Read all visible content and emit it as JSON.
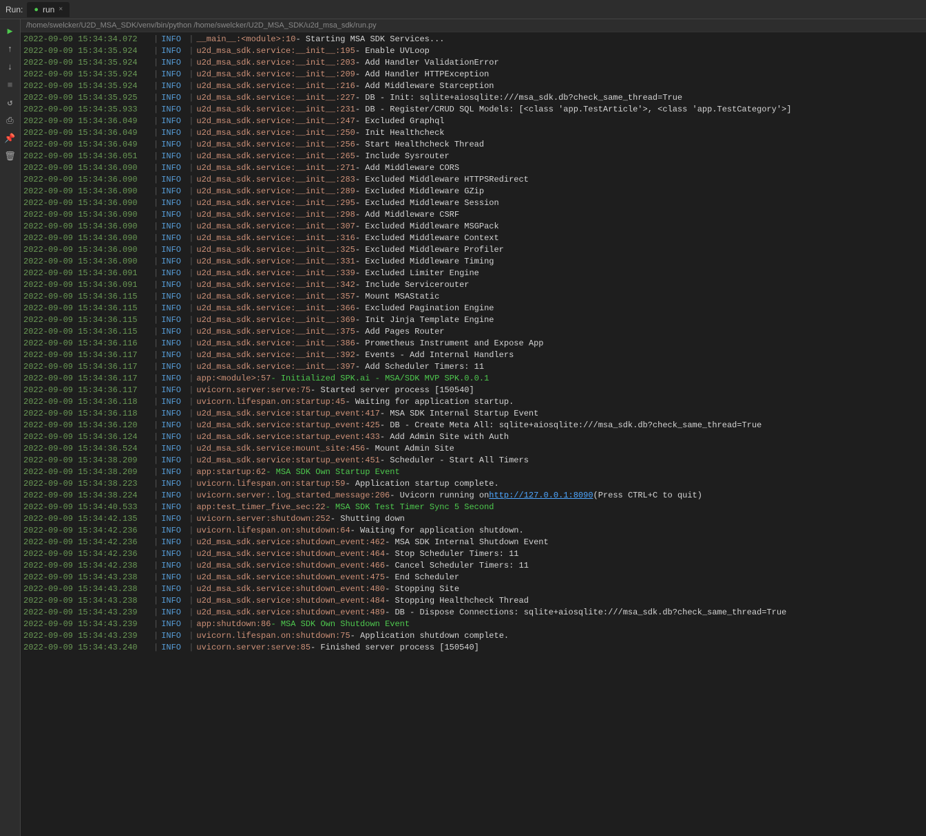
{
  "topbar": {
    "run_label": "Run:",
    "tab_label": "run",
    "tab_close": "×"
  },
  "path_bar": "/home/swelcker/U2D_MSA_SDK/venv/bin/python /home/swelcker/U2D_MSA_SDK/u2d_msa_sdk/run.py",
  "toolbar": {
    "play": "▶",
    "up": "↑",
    "down": "↓",
    "stop": "■",
    "rerun": "↺",
    "print": "⎙",
    "pin": "📌",
    "trash": "🗑"
  },
  "log_lines": [
    {
      "ts": "2022-09-09 15:34:34.072",
      "level": "INFO",
      "source": "__main__:<module>:10",
      "msg": " - Starting MSA SDK Services...",
      "color": "plain"
    },
    {
      "ts": "2022-09-09 15:34:35.924",
      "level": "INFO",
      "source": "u2d_msa_sdk.service:__init__:195",
      "msg": " - Enable UVLoop",
      "color": "plain"
    },
    {
      "ts": "2022-09-09 15:34:35.924",
      "level": "INFO",
      "source": "u2d_msa_sdk.service:__init__:203",
      "msg": " - Add Handler ValidationError",
      "color": "plain"
    },
    {
      "ts": "2022-09-09 15:34:35.924",
      "level": "INFO",
      "source": "u2d_msa_sdk.service:__init__:209",
      "msg": " - Add Handler HTTPException",
      "color": "plain"
    },
    {
      "ts": "2022-09-09 15:34:35.924",
      "level": "INFO",
      "source": "u2d_msa_sdk.service:__init__:216",
      "msg": " - Add Middleware Starception",
      "color": "plain"
    },
    {
      "ts": "2022-09-09 15:34:35.925",
      "level": "INFO",
      "source": "u2d_msa_sdk.service:__init__:227",
      "msg": " - DB - Init: sqlite+aiosqlite:///msa_sdk.db?check_same_thread=True",
      "color": "plain"
    },
    {
      "ts": "2022-09-09 15:34:35.933",
      "level": "INFO",
      "source": "u2d_msa_sdk.service:__init__:231",
      "msg": " - DB - Register/CRUD SQL Models: [<class 'app.TestArticle'>, <class 'app.TestCategory'>]",
      "color": "plain"
    },
    {
      "ts": "2022-09-09 15:34:36.049",
      "level": "INFO",
      "source": "u2d_msa_sdk.service:__init__:247",
      "msg": " - Excluded Graphql",
      "color": "plain"
    },
    {
      "ts": "2022-09-09 15:34:36.049",
      "level": "INFO",
      "source": "u2d_msa_sdk.service:__init__:250",
      "msg": " - Init Healthcheck",
      "color": "plain"
    },
    {
      "ts": "2022-09-09 15:34:36.049",
      "level": "INFO",
      "source": "u2d_msa_sdk.service:__init__:256",
      "msg": " - Start Healthcheck Thread",
      "color": "plain"
    },
    {
      "ts": "2022-09-09 15:34:36.051",
      "level": "INFO",
      "source": "u2d_msa_sdk.service:__init__:265",
      "msg": " - Include Sysrouter",
      "color": "plain"
    },
    {
      "ts": "2022-09-09 15:34:36.090",
      "level": "INFO",
      "source": "u2d_msa_sdk.service:__init__:271",
      "msg": " - Add Middleware CORS",
      "color": "plain"
    },
    {
      "ts": "2022-09-09 15:34:36.090",
      "level": "INFO",
      "source": "u2d_msa_sdk.service:__init__:283",
      "msg": " - Excluded Middleware HTTPSRedirect",
      "color": "plain"
    },
    {
      "ts": "2022-09-09 15:34:36.090",
      "level": "INFO",
      "source": "u2d_msa_sdk.service:__init__:289",
      "msg": " - Excluded Middleware GZip",
      "color": "plain"
    },
    {
      "ts": "2022-09-09 15:34:36.090",
      "level": "INFO",
      "source": "u2d_msa_sdk.service:__init__:295",
      "msg": " - Excluded Middleware Session",
      "color": "plain"
    },
    {
      "ts": "2022-09-09 15:34:36.090",
      "level": "INFO",
      "source": "u2d_msa_sdk.service:__init__:298",
      "msg": " - Add Middleware CSRF",
      "color": "plain"
    },
    {
      "ts": "2022-09-09 15:34:36.090",
      "level": "INFO",
      "source": "u2d_msa_sdk.service:__init__:307",
      "msg": " - Excluded Middleware MSGPack",
      "color": "plain"
    },
    {
      "ts": "2022-09-09 15:34:36.090",
      "level": "INFO",
      "source": "u2d_msa_sdk.service:__init__:316",
      "msg": " - Excluded Middleware Context",
      "color": "plain"
    },
    {
      "ts": "2022-09-09 15:34:36.090",
      "level": "INFO",
      "source": "u2d_msa_sdk.service:__init__:325",
      "msg": " - Excluded Middleware Profiler",
      "color": "plain"
    },
    {
      "ts": "2022-09-09 15:34:36.090",
      "level": "INFO",
      "source": "u2d_msa_sdk.service:__init__:331",
      "msg": " - Excluded Middleware Timing",
      "color": "plain"
    },
    {
      "ts": "2022-09-09 15:34:36.091",
      "level": "INFO",
      "source": "u2d_msa_sdk.service:__init__:339",
      "msg": " - Excluded Limiter Engine",
      "color": "plain"
    },
    {
      "ts": "2022-09-09 15:34:36.091",
      "level": "INFO",
      "source": "u2d_msa_sdk.service:__init__:342",
      "msg": " - Include Servicerouter",
      "color": "plain"
    },
    {
      "ts": "2022-09-09 15:34:36.115",
      "level": "INFO",
      "source": "u2d_msa_sdk.service:__init__:357",
      "msg": " - Mount MSAStatic",
      "color": "plain"
    },
    {
      "ts": "2022-09-09 15:34:36.115",
      "level": "INFO",
      "source": "u2d_msa_sdk.service:__init__:366",
      "msg": " - Excluded Pagination Engine",
      "color": "plain"
    },
    {
      "ts": "2022-09-09 15:34:36.115",
      "level": "INFO",
      "source": "u2d_msa_sdk.service:__init__:369",
      "msg": " - Init Jinja Template Engine",
      "color": "plain"
    },
    {
      "ts": "2022-09-09 15:34:36.115",
      "level": "INFO",
      "source": "u2d_msa_sdk.service:__init__:375",
      "msg": " - Add Pages Router",
      "color": "plain"
    },
    {
      "ts": "2022-09-09 15:34:36.116",
      "level": "INFO",
      "source": "u2d_msa_sdk.service:__init__:386",
      "msg": " - Prometheus Instrument and Expose App",
      "color": "plain"
    },
    {
      "ts": "2022-09-09 15:34:36.117",
      "level": "INFO",
      "source": "u2d_msa_sdk.service:__init__:392",
      "msg": " - Events - Add Internal Handlers",
      "color": "plain"
    },
    {
      "ts": "2022-09-09 15:34:36.117",
      "level": "INFO",
      "source": "u2d_msa_sdk.service:__init__:397",
      "msg": " - Add Scheduler Timers: 11",
      "color": "plain"
    },
    {
      "ts": "2022-09-09 15:34:36.117",
      "level": "INFO",
      "source": "app:<module>:57",
      "msg": " - Initialized SPK.ai - MSA/SDK MVP SPK.0.0.1",
      "color": "green"
    },
    {
      "ts": "2022-09-09 15:34:36.117",
      "level": "INFO",
      "source": "uvicorn.server:serve:75",
      "msg": " - Started server process [150540]",
      "color": "plain"
    },
    {
      "ts": "2022-09-09 15:34:36.118",
      "level": "INFO",
      "source": "uvicorn.lifespan.on:startup:45",
      "msg": " - Waiting for application startup.",
      "color": "plain"
    },
    {
      "ts": "2022-09-09 15:34:36.118",
      "level": "INFO",
      "source": "u2d_msa_sdk.service:startup_event:417",
      "msg": " - MSA SDK Internal Startup Event",
      "color": "plain"
    },
    {
      "ts": "2022-09-09 15:34:36.120",
      "level": "INFO",
      "source": "u2d_msa_sdk.service:startup_event:425",
      "msg": " - DB - Create Meta All: sqlite+aiosqlite:///msa_sdk.db?check_same_thread=True",
      "color": "plain"
    },
    {
      "ts": "2022-09-09 15:34:36.124",
      "level": "INFO",
      "source": "u2d_msa_sdk.service:startup_event:433",
      "msg": " - Add Admin Site with Auth",
      "color": "plain"
    },
    {
      "ts": "2022-09-09 15:34:36.524",
      "level": "INFO",
      "source": "u2d_msa_sdk.service:mount_site:456",
      "msg": " - Mount Admin Site",
      "color": "plain"
    },
    {
      "ts": "2022-09-09 15:34:38.209",
      "level": "INFO",
      "source": "u2d_msa_sdk.service:startup_event:451",
      "msg": " - Scheduler - Start All Timers",
      "color": "plain"
    },
    {
      "ts": "2022-09-09 15:34:38.209",
      "level": "INFO",
      "source": "app:startup:62",
      "msg": " - MSA SDK Own Startup Event",
      "color": "green"
    },
    {
      "ts": "2022-09-09 15:34:38.223",
      "level": "INFO",
      "source": "uvicorn.lifespan.on:startup:59",
      "msg": " - Application startup complete.",
      "color": "plain"
    },
    {
      "ts": "2022-09-09 15:34:38.224",
      "level": "INFO",
      "source": "uvicorn.server:.log_started_message:206",
      "msg": " - Uvicorn running on ",
      "color": "link",
      "link": "http://127.0.0.1:8090",
      "link_text": "http://127.0.0.1:8090",
      "after": " (Press CTRL+C to quit)"
    },
    {
      "ts": "2022-09-09 15:34:40.533",
      "level": "INFO",
      "source": "app:test_timer_five_sec:22",
      "msg": " - MSA SDK Test Timer Sync 5 Second",
      "color": "green"
    },
    {
      "ts": "2022-09-09 15:34:42.135",
      "level": "INFO",
      "source": "uvicorn.server:shutdown:252",
      "msg": " - Shutting down",
      "color": "plain"
    },
    {
      "ts": "2022-09-09 15:34:42.236",
      "level": "INFO",
      "source": "uvicorn.lifespan.on:shutdown:64",
      "msg": " - Waiting for application shutdown.",
      "color": "plain"
    },
    {
      "ts": "2022-09-09 15:34:42.236",
      "level": "INFO",
      "source": "u2d_msa_sdk.service:shutdown_event:462",
      "msg": " - MSA SDK Internal Shutdown Event",
      "color": "plain"
    },
    {
      "ts": "2022-09-09 15:34:42.236",
      "level": "INFO",
      "source": "u2d_msa_sdk.service:shutdown_event:464",
      "msg": " - Stop Scheduler Timers: 11",
      "color": "plain"
    },
    {
      "ts": "2022-09-09 15:34:42.238",
      "level": "INFO",
      "source": "u2d_msa_sdk.service:shutdown_event:466",
      "msg": " - Cancel Scheduler Timers: 11",
      "color": "plain"
    },
    {
      "ts": "2022-09-09 15:34:43.238",
      "level": "INFO",
      "source": "u2d_msa_sdk.service:shutdown_event:475",
      "msg": " - End Scheduler",
      "color": "plain"
    },
    {
      "ts": "2022-09-09 15:34:43.238",
      "level": "INFO",
      "source": "u2d_msa_sdk.service:shutdown_event:480",
      "msg": " - Stopping Site",
      "color": "plain"
    },
    {
      "ts": "2022-09-09 15:34:43.238",
      "level": "INFO",
      "source": "u2d_msa_sdk.service:shutdown_event:484",
      "msg": " - Stopping Healthcheck Thread",
      "color": "plain"
    },
    {
      "ts": "2022-09-09 15:34:43.239",
      "level": "INFO",
      "source": "u2d_msa_sdk.service:shutdown_event:489",
      "msg": " - DB - Dispose Connections: sqlite+aiosqlite:///msa_sdk.db?check_same_thread=True",
      "color": "plain"
    },
    {
      "ts": "2022-09-09 15:34:43.239",
      "level": "INFO",
      "source": "app:shutdown:86",
      "msg": " - MSA SDK Own Shutdown Event",
      "color": "green"
    },
    {
      "ts": "2022-09-09 15:34:43.239",
      "level": "INFO",
      "source": "uvicorn.lifespan.on:shutdown:75",
      "msg": " - Application shutdown complete.",
      "color": "plain"
    },
    {
      "ts": "2022-09-09 15:34:43.240",
      "level": "INFO",
      "source": "uvicorn.server:serve:85",
      "msg": " - Finished server process [150540]",
      "color": "plain"
    }
  ]
}
